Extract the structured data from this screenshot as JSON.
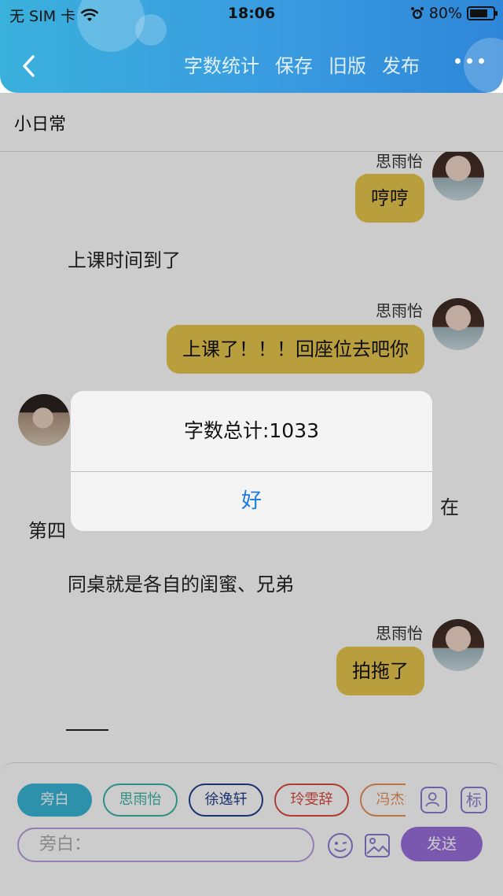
{
  "status": {
    "carrier": "无 SIM 卡",
    "time": "18:06",
    "battery": "80%",
    "battery_level": 0.8
  },
  "nav": {
    "actions": [
      "字数统计",
      "保存",
      "旧版",
      "发布"
    ]
  },
  "page": {
    "title": "小日常"
  },
  "chat": {
    "messages": [
      {
        "speaker": "思雨怡",
        "text": "哼哼"
      },
      {
        "narration": "上课时间到了"
      },
      {
        "speaker": "思雨怡",
        "text": "上课了！！！回座位去吧你"
      },
      {
        "narration_partial_1": "",
        "narration_partial_2": ""
      },
      {
        "narration": "同桌就是各自的闺蜜、兄弟"
      },
      {
        "speaker": "思雨怡",
        "text": "拍拖了"
      }
    ],
    "hidden_fragments": {
      "right": "在",
      "left": "第四"
    }
  },
  "composer": {
    "chips": [
      {
        "label": "旁白",
        "color": "#3ab6d6"
      },
      {
        "label": "思雨怡",
        "color": "#3bb3a3"
      },
      {
        "label": "徐逸轩",
        "color": "#243f8a"
      },
      {
        "label": "玲雯辞",
        "color": "#d94a3e"
      },
      {
        "label": "冯杰渊",
        "color": "#e8905a"
      }
    ],
    "extra_icon": "标",
    "placeholder": "旁白：",
    "send_label": "发送"
  },
  "dialog": {
    "message": "字数总计:1033",
    "ok_label": "好"
  }
}
